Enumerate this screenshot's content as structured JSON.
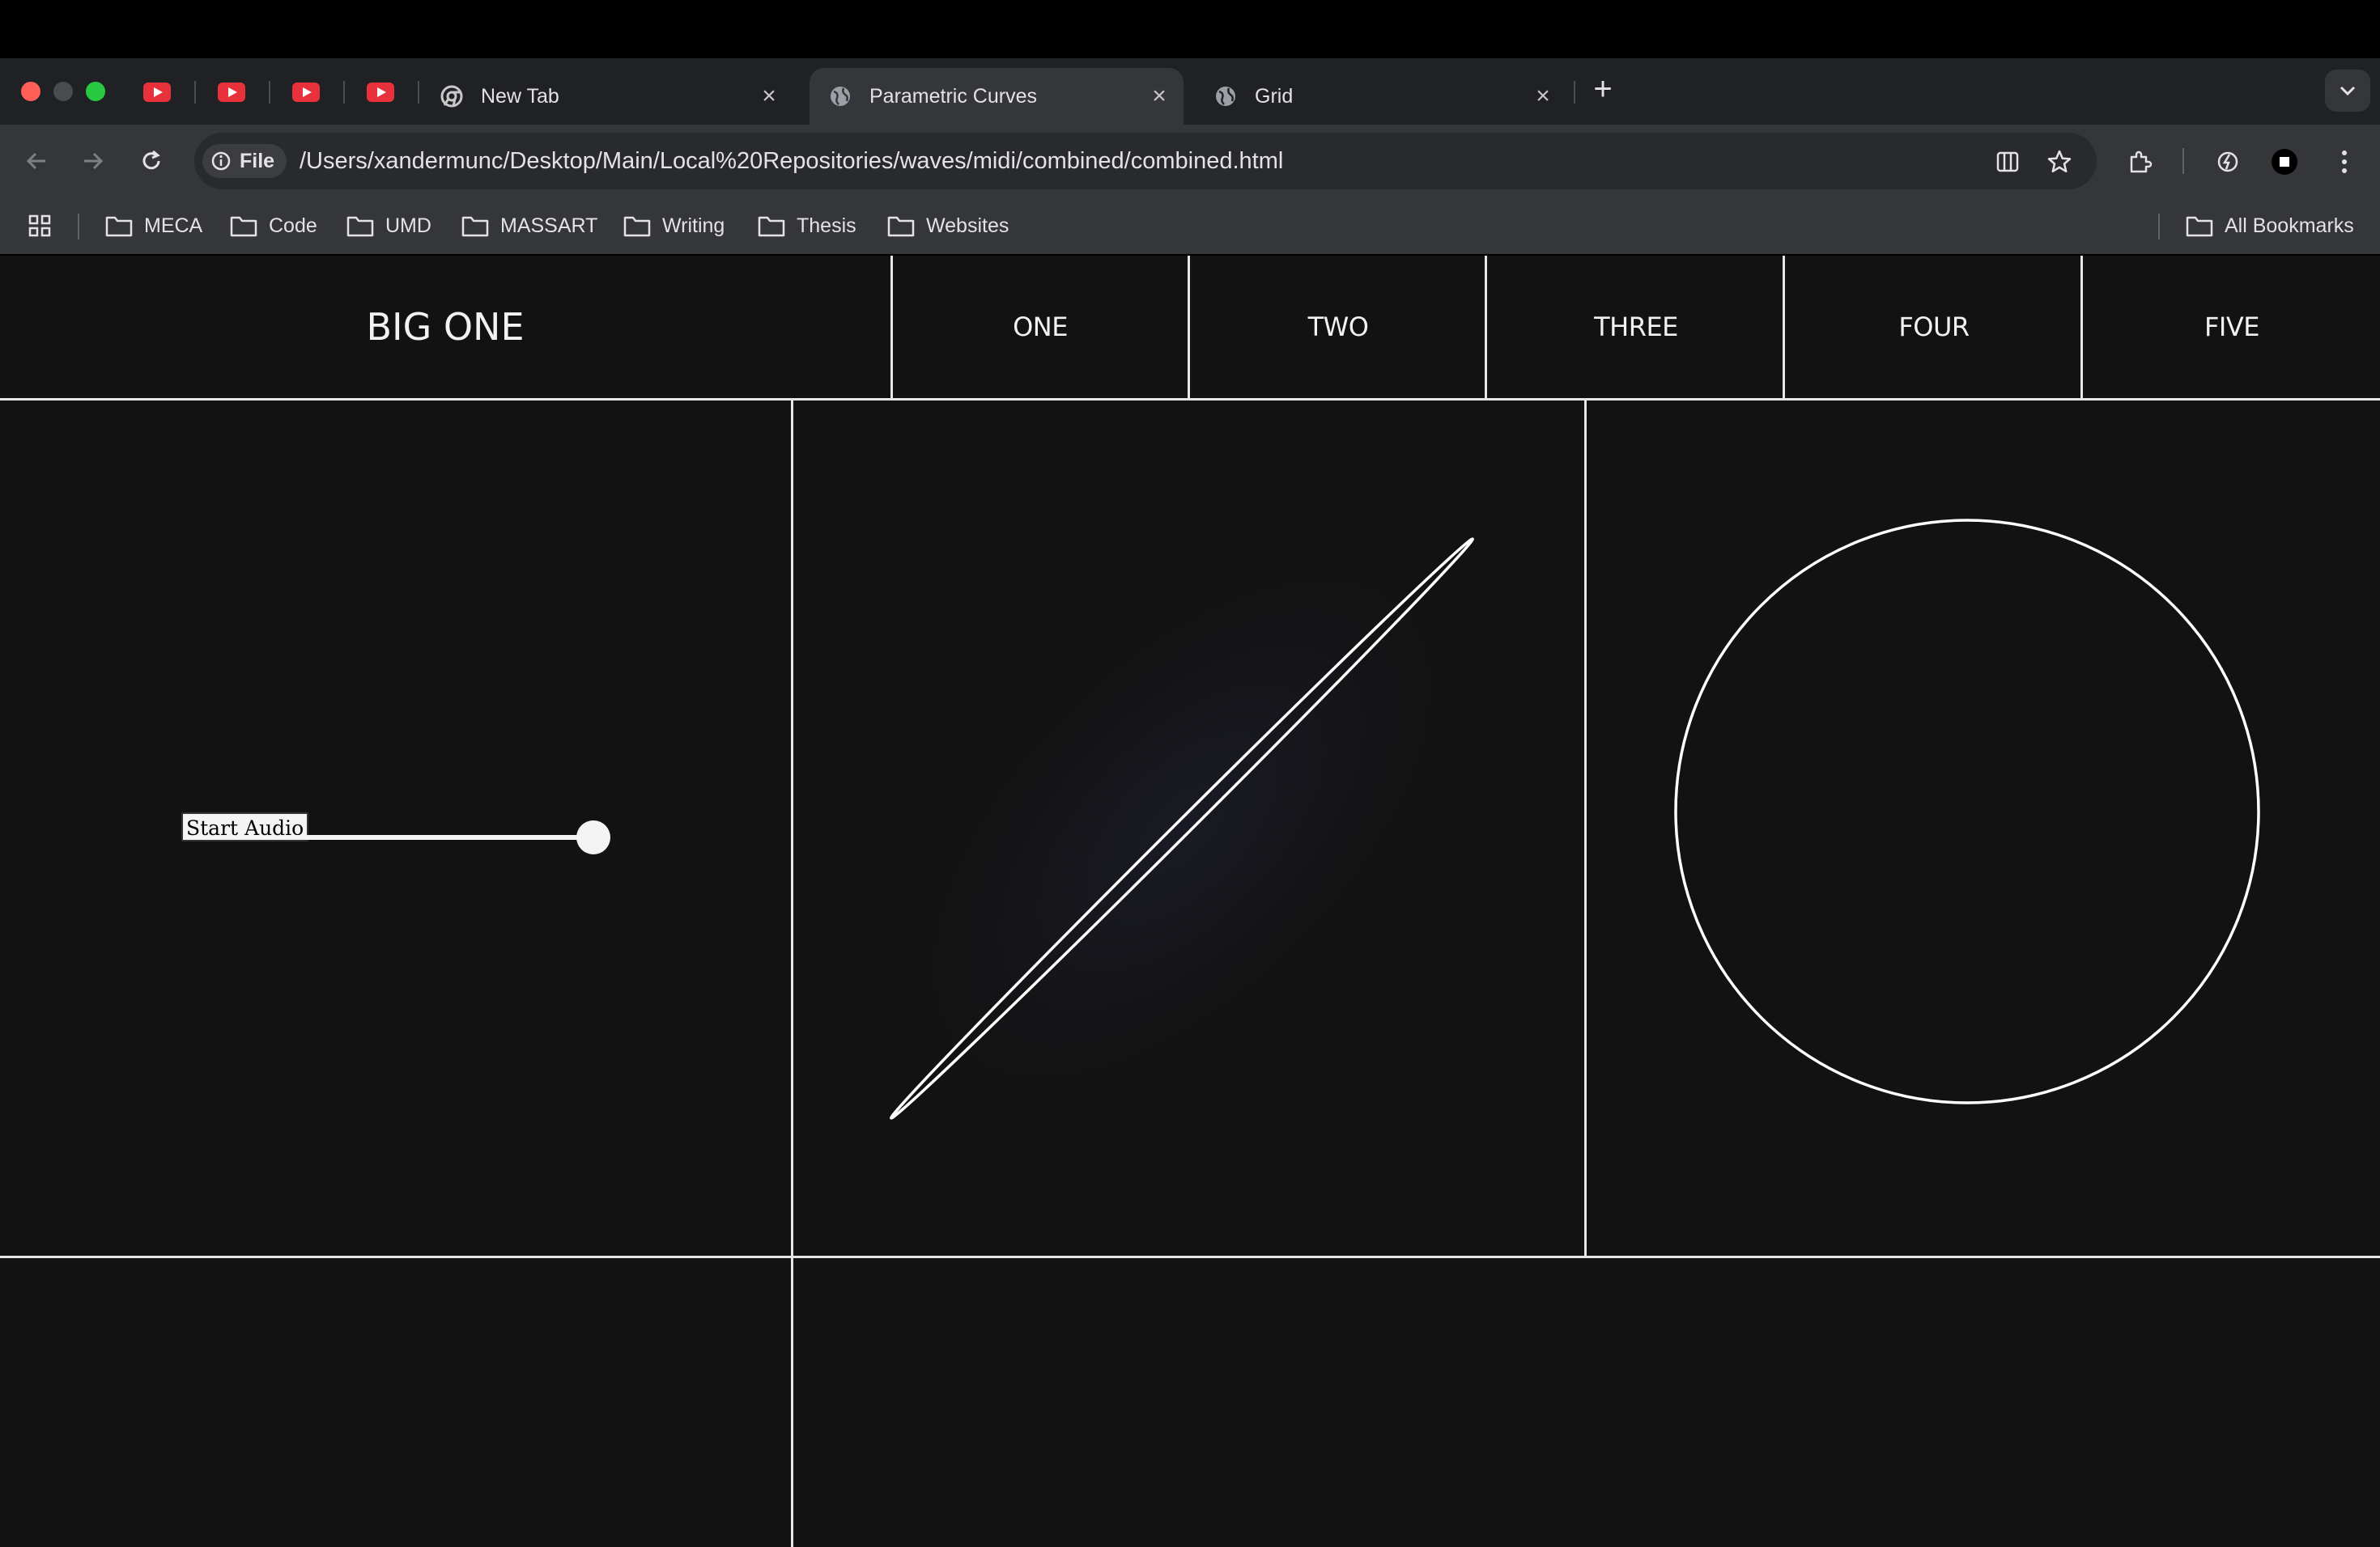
{
  "browser": {
    "tabs": [
      {
        "title": "New Tab",
        "icon": "chrome-icon"
      },
      {
        "title": "Parametric Curves",
        "icon": "globe-icon",
        "active": true
      },
      {
        "title": "Grid",
        "icon": "globe-icon"
      }
    ],
    "pinned_tabs": [
      "youtube-icon",
      "youtube-icon",
      "youtube-icon",
      "youtube-icon"
    ],
    "chip_label": "File",
    "url": "/Users/xandermunc/Desktop/Main/Local%20Repositories/waves/midi/combined/combined.html",
    "bookmarks": [
      "MECA",
      "Code",
      "UMD",
      "MASSART",
      "Writing",
      "Thesis",
      "Websites"
    ],
    "all_bookmarks": "All Bookmarks"
  },
  "page": {
    "nav": {
      "big": "BIG ONE",
      "items": [
        "ONE",
        "TWO",
        "THREE",
        "FOUR",
        "FIVE"
      ]
    },
    "start_audio_label": "Start Audio",
    "slider_value": 1.0,
    "colors": {
      "background": "#121212",
      "lines": "#e6e6e6"
    }
  }
}
